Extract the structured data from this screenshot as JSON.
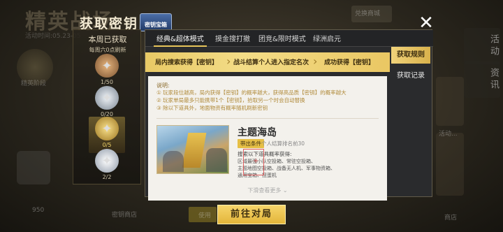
{
  "background": {
    "title": "精英战场",
    "date": "活动时间:05.23-05",
    "right_tab": "兑换商城",
    "left_label": "精英阶段",
    "side_tabs": [
      "活动",
      "资讯"
    ],
    "bottom_labels": [
      "950",
      "密钥商店",
      "使用",
      "商店"
    ],
    "right_card_text": "活动..."
  },
  "modal": {
    "title": "获取密钥",
    "badge": "密钥宝箱",
    "close_icon": "close-icon"
  },
  "left_panel": {
    "title": "本周已获取",
    "subtitle": "每周六0点刷新",
    "tiers": [
      {
        "count": "1/50",
        "icon": "bronze-emblem-icon",
        "color": "#b98a55"
      },
      {
        "count": "0/20",
        "icon": "silver-emblem-icon",
        "color": "#c9d2dc"
      },
      {
        "count": "0/5",
        "icon": "gold-emblem-icon",
        "color": "#e2bd4e",
        "active": true
      },
      {
        "count": "2/2",
        "icon": "platinum-emblem-icon",
        "color": "#d7dde6"
      }
    ]
  },
  "tabs": [
    "经典&超体模式",
    "摸金搜打撤",
    "团竞&限时模式",
    "绿洲启元"
  ],
  "active_tab": 0,
  "steps": [
    "局内搜索获得【密钥】",
    "战斗结算个人进入指定名次",
    "成功获得【密钥】"
  ],
  "description": {
    "title": "说明:",
    "lines": [
      "① 玩家段位越高，局内获得【密钥】的概率越大，获得高品质【密钥】的概率越大",
      "② 玩家单局最多只能携带1个【密钥】，拾取另一个时会自动替换",
      "③ 除以下道具外，地面物资有概率随机刷新密钥"
    ]
  },
  "map": {
    "name": "主题海岛",
    "condition_badge": "带出条件",
    "condition_text": "个人结算排名前30",
    "search_title": "搜索以下道具概率获得:",
    "search_lines": [
      "区域最强小队空投箱、常驻空投箱、",
      "主题地图空投箱、战备无人机、军事物资箱、",
      "通用宝箱、扭蛋机"
    ]
  },
  "more_hint": "下滑查看更多 ⌄",
  "side_tabs": [
    "获取规则",
    "获取记录"
  ],
  "active_side_tab": 0,
  "go_button": "前往对局"
}
